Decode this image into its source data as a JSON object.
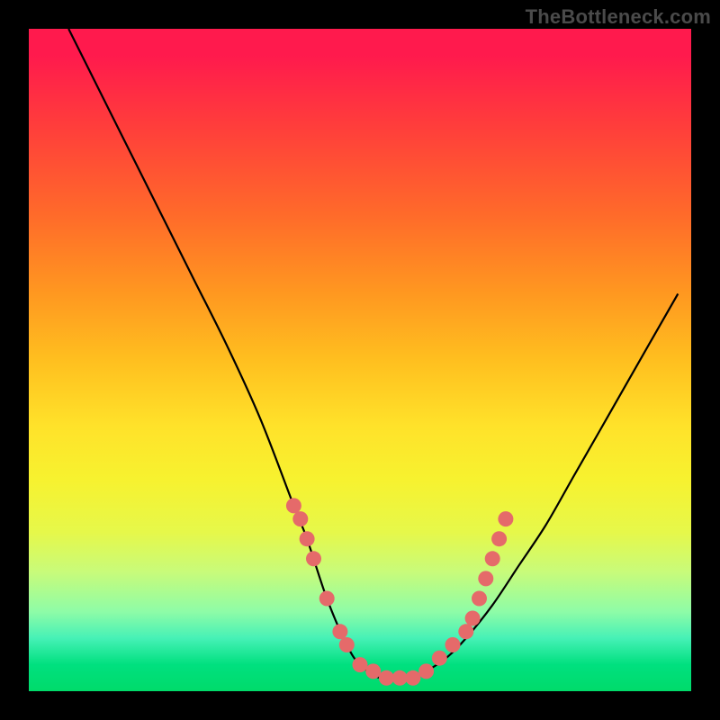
{
  "watermark": "TheBottleneck.com",
  "colors": {
    "background": "#000000",
    "curve_stroke": "#000000",
    "marker_fill": "#e56a6a",
    "gradient_stops": [
      "#ff1a4d",
      "#ff3b3c",
      "#ff6a2a",
      "#ff9820",
      "#ffbf1f",
      "#ffe22a",
      "#f7f22f",
      "#e6f84a",
      "#c8fb7a",
      "#8efca7",
      "#46f1b6",
      "#00e07f",
      "#00db6a"
    ]
  },
  "chart_data": {
    "type": "line",
    "title": "",
    "xlabel": "",
    "ylabel": "",
    "xlim": [
      0,
      1
    ],
    "ylim": [
      0,
      1
    ],
    "series": [
      {
        "name": "bottleneck-curve",
        "x": [
          0.06,
          0.1,
          0.15,
          0.2,
          0.25,
          0.3,
          0.35,
          0.4,
          0.42,
          0.45,
          0.48,
          0.5,
          0.53,
          0.56,
          0.58,
          0.6,
          0.63,
          0.66,
          0.7,
          0.74,
          0.78,
          0.82,
          0.86,
          0.9,
          0.94,
          0.98
        ],
        "y": [
          1.0,
          0.92,
          0.82,
          0.72,
          0.62,
          0.52,
          0.41,
          0.28,
          0.23,
          0.14,
          0.07,
          0.04,
          0.02,
          0.02,
          0.02,
          0.03,
          0.05,
          0.08,
          0.13,
          0.19,
          0.25,
          0.32,
          0.39,
          0.46,
          0.53,
          0.6
        ]
      }
    ],
    "markers": [
      {
        "x": 0.4,
        "y": 0.28
      },
      {
        "x": 0.41,
        "y": 0.26
      },
      {
        "x": 0.42,
        "y": 0.23
      },
      {
        "x": 0.43,
        "y": 0.2
      },
      {
        "x": 0.45,
        "y": 0.14
      },
      {
        "x": 0.47,
        "y": 0.09
      },
      {
        "x": 0.48,
        "y": 0.07
      },
      {
        "x": 0.5,
        "y": 0.04
      },
      {
        "x": 0.52,
        "y": 0.03
      },
      {
        "x": 0.54,
        "y": 0.02
      },
      {
        "x": 0.56,
        "y": 0.02
      },
      {
        "x": 0.58,
        "y": 0.02
      },
      {
        "x": 0.6,
        "y": 0.03
      },
      {
        "x": 0.62,
        "y": 0.05
      },
      {
        "x": 0.64,
        "y": 0.07
      },
      {
        "x": 0.66,
        "y": 0.09
      },
      {
        "x": 0.67,
        "y": 0.11
      },
      {
        "x": 0.68,
        "y": 0.14
      },
      {
        "x": 0.69,
        "y": 0.17
      },
      {
        "x": 0.7,
        "y": 0.2
      },
      {
        "x": 0.71,
        "y": 0.23
      },
      {
        "x": 0.72,
        "y": 0.26
      }
    ]
  }
}
